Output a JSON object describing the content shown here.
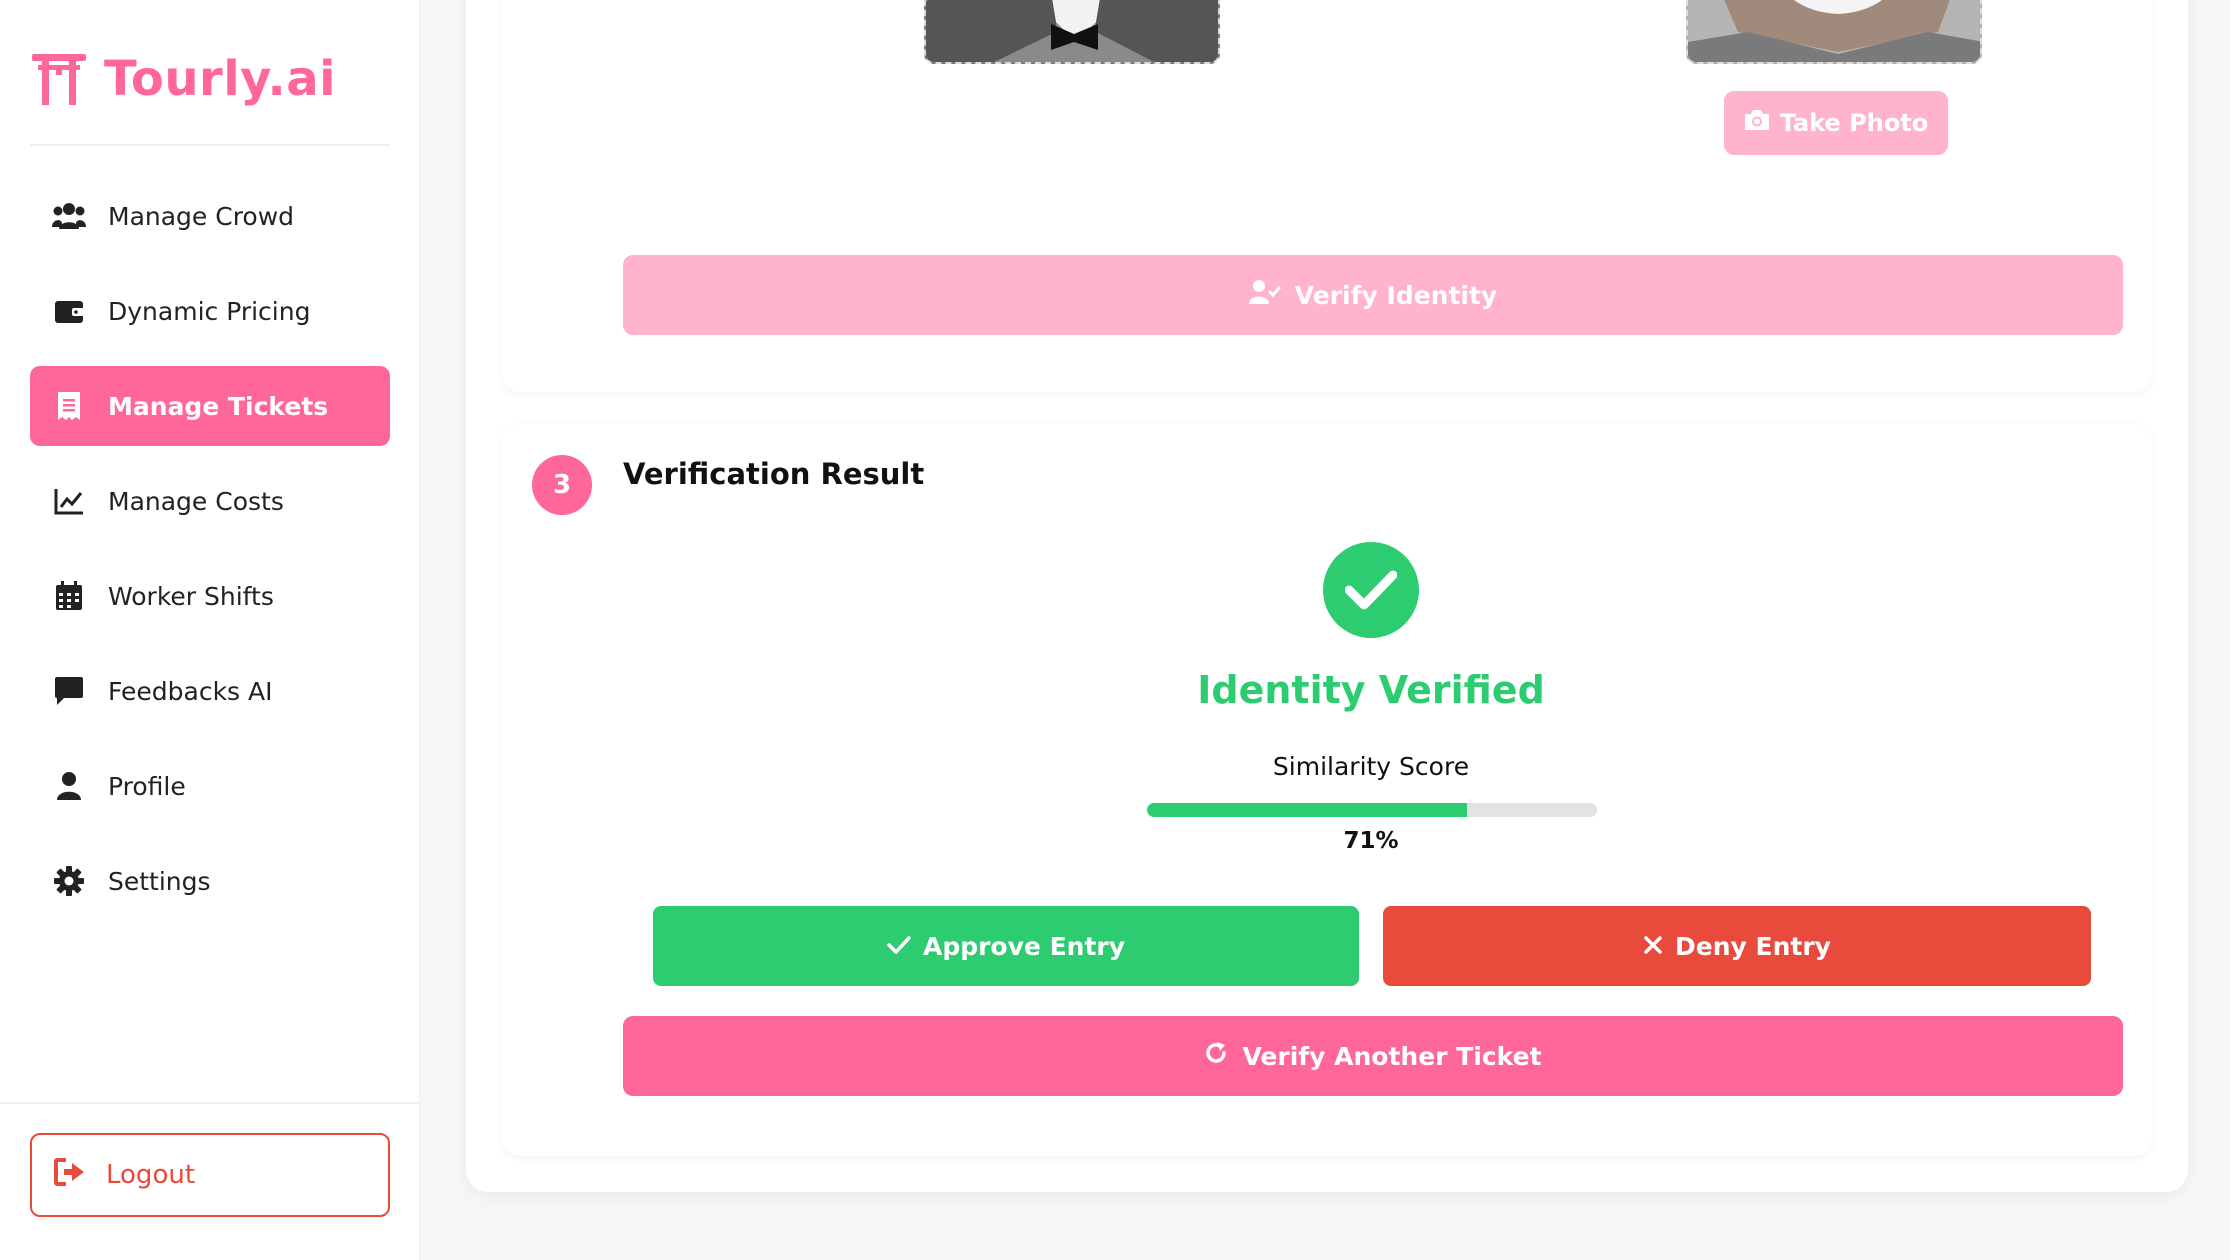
{
  "brand": {
    "name": "Tourly.ai",
    "color": "#ff6699"
  },
  "sidebar": {
    "items": [
      {
        "label": "Manage Crowd",
        "icon": "users-icon"
      },
      {
        "label": "Dynamic Pricing",
        "icon": "wallet-icon"
      },
      {
        "label": "Manage Tickets",
        "icon": "receipt-icon",
        "active": true
      },
      {
        "label": "Manage Costs",
        "icon": "line-chart-icon"
      },
      {
        "label": "Worker Shifts",
        "icon": "calendar-icon"
      },
      {
        "label": "Feedbacks AI",
        "icon": "message-icon"
      },
      {
        "label": "Profile",
        "icon": "user-icon"
      },
      {
        "label": "Settings",
        "icon": "gear-icon"
      }
    ],
    "logout_label": "Logout"
  },
  "capture": {
    "take_photo_label": "Take Photo",
    "verify_identity_label": "Verify Identity"
  },
  "result": {
    "step_number": "3",
    "title": "Verification Result",
    "status": "Identity Verified",
    "score_label": "Similarity Score",
    "score_value": "71%",
    "score_fraction": 0.71,
    "approve_label": "Approve Entry",
    "deny_label": "Deny Entry",
    "verify_another_label": "Verify Another Ticket"
  },
  "colors": {
    "accent": "#ff6699",
    "accent_light": "#ffb3cc",
    "success": "#2ecc71",
    "danger": "#e84a3c"
  }
}
